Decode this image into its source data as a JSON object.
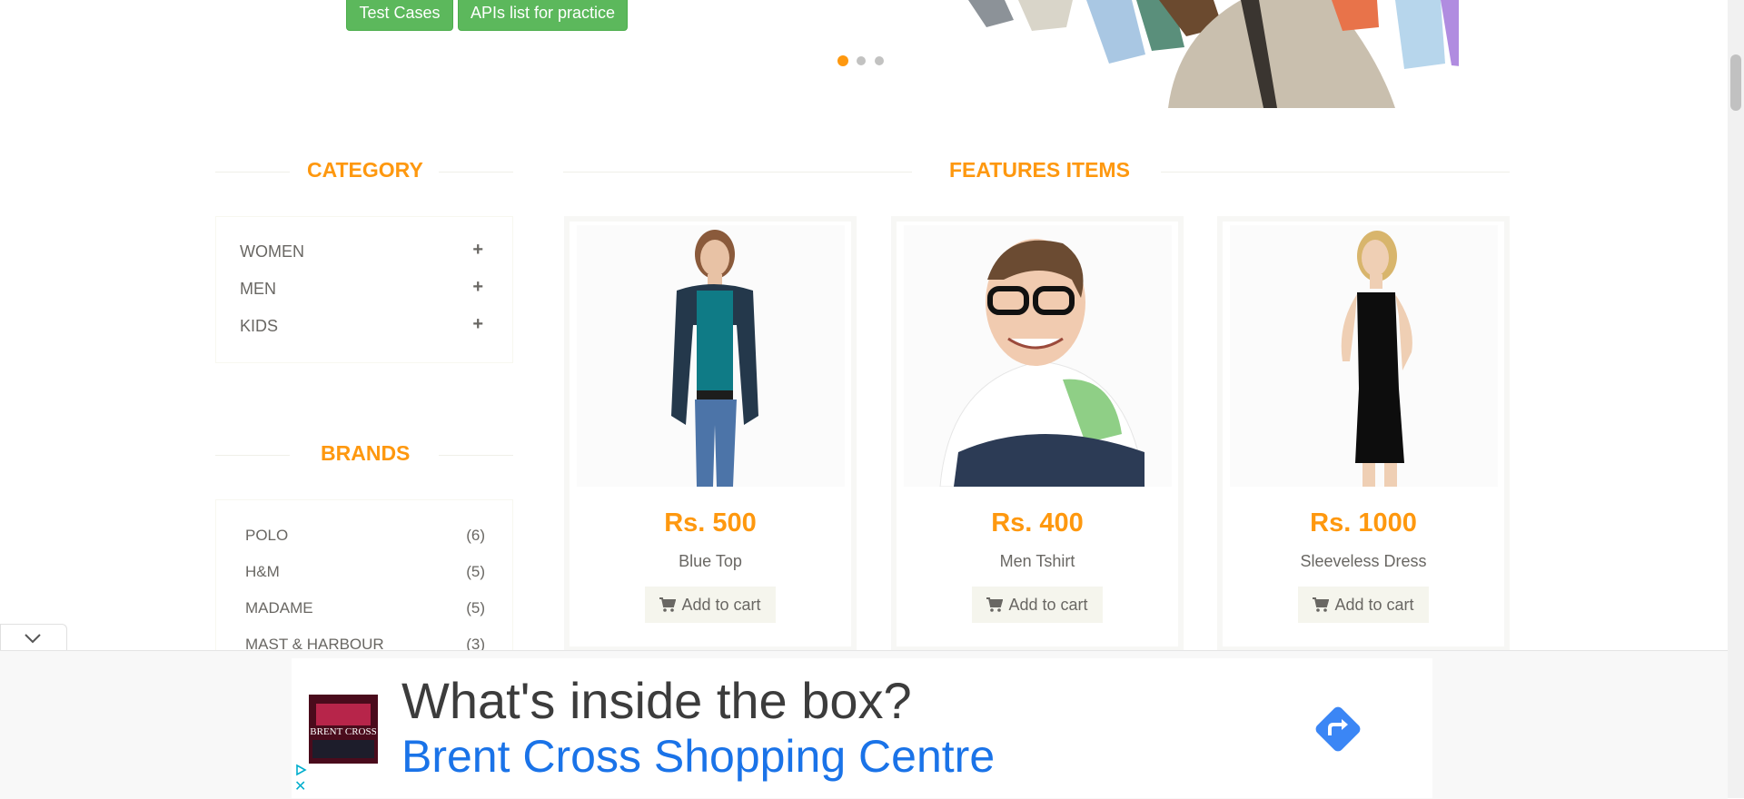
{
  "top_buttons": {
    "test_cases": "Test Cases",
    "apis_list": "APIs list for practice"
  },
  "slider": {
    "dots": 3,
    "active_index": 0
  },
  "category": {
    "title": "CATEGORY",
    "items": [
      {
        "label": "WOMEN"
      },
      {
        "label": "MEN"
      },
      {
        "label": "KIDS"
      }
    ]
  },
  "brands": {
    "title": "BRANDS",
    "items": [
      {
        "name": "POLO",
        "count": "(6)"
      },
      {
        "name": "H&M",
        "count": "(5)"
      },
      {
        "name": "MADAME",
        "count": "(5)"
      },
      {
        "name": "MAST & HARBOUR",
        "count": "(3)"
      }
    ]
  },
  "features": {
    "title": "FEATURES ITEMS",
    "products": [
      {
        "price": "Rs. 500",
        "name": "Blue Top",
        "cart_label": "Add to cart"
      },
      {
        "price": "Rs. 400",
        "name": "Men Tshirt",
        "cart_label": "Add to cart"
      },
      {
        "price": "Rs. 1000",
        "name": "Sleeveless Dress",
        "cart_label": "Add to cart"
      }
    ]
  },
  "ad": {
    "headline": "What's inside the box?",
    "advertiser": "Brent Cross Shopping Centre",
    "logo_text": "BRENT CROSS"
  },
  "colors": {
    "accent": "#fe980f",
    "green": "#5cb85c",
    "ad_blue": "#1a73e8"
  }
}
